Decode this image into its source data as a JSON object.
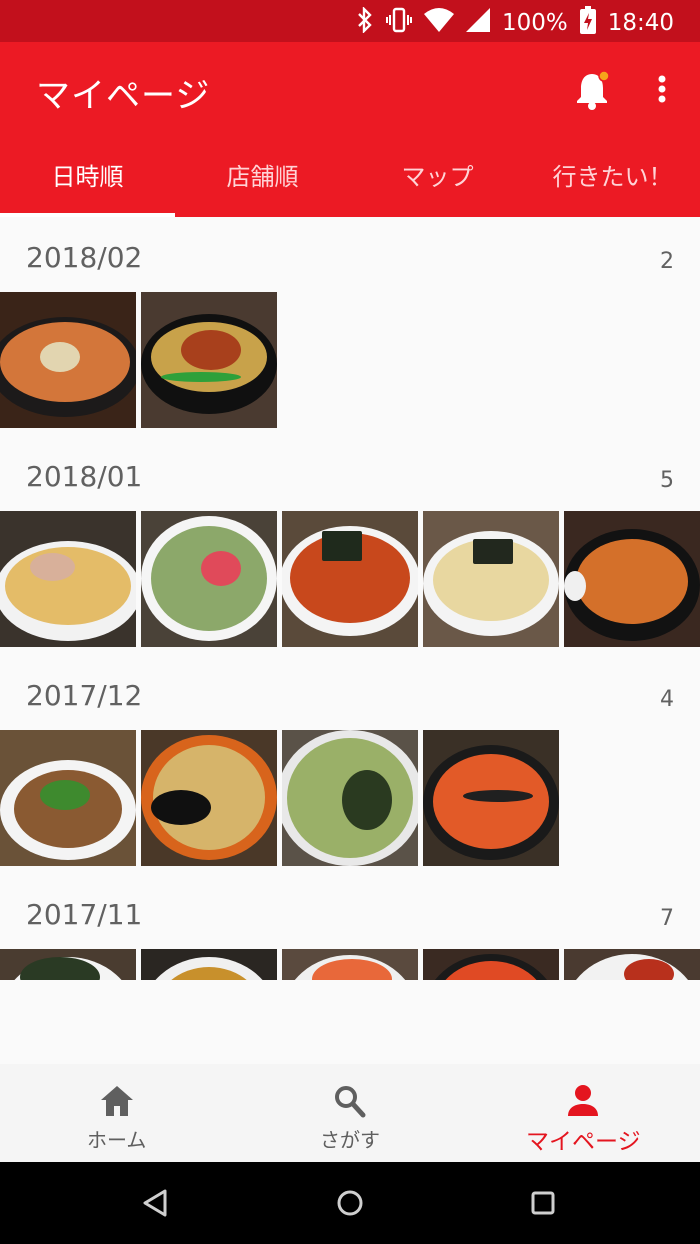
{
  "status": {
    "battery": "100%",
    "time": "18:40"
  },
  "appbar": {
    "title": "マイページ"
  },
  "tabs": [
    {
      "label": "日時順",
      "active": true
    },
    {
      "label": "店舗順"
    },
    {
      "label": "マップ"
    },
    {
      "label": "行きたい！"
    }
  ],
  "sections": [
    {
      "date": "2018/02",
      "count": "2"
    },
    {
      "date": "2018/01",
      "count": "5"
    },
    {
      "date": "2017/12",
      "count": "4"
    },
    {
      "date": "2017/11",
      "count": "7"
    }
  ],
  "bottom_nav": [
    {
      "label": "ホーム"
    },
    {
      "label": "さがす"
    },
    {
      "label": "マイページ",
      "active": true
    }
  ],
  "colors": {
    "primary": "#ec1a24",
    "statusbar": "#c2101c",
    "active_nav": "#e4151f"
  }
}
